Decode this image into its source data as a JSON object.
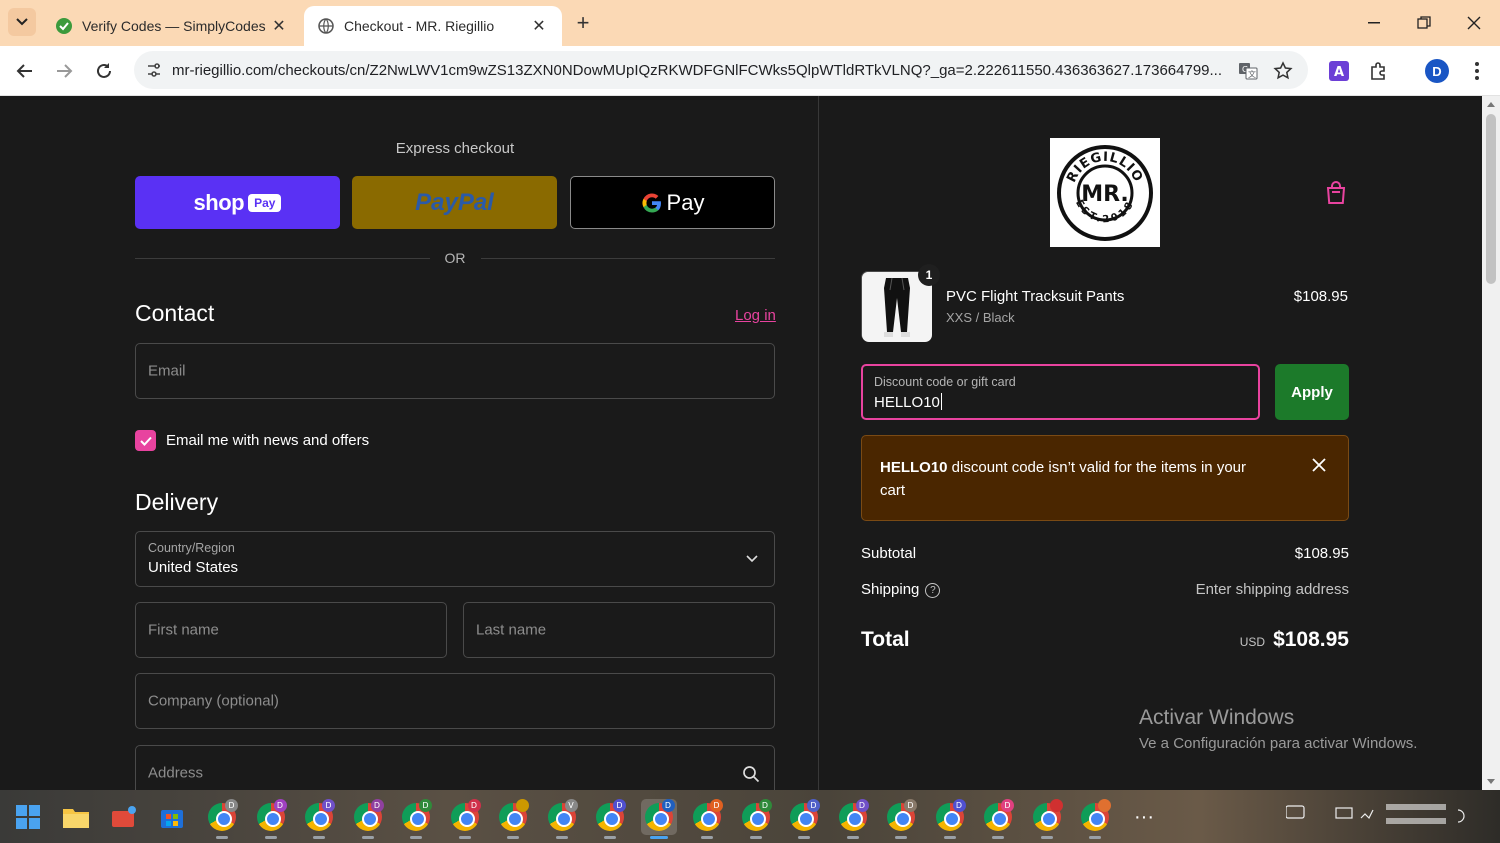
{
  "browser": {
    "tabs": [
      {
        "title": "Verify Codes — SimplyCodes",
        "active": false
      },
      {
        "title": "Checkout - MR. Riegillio",
        "active": true
      }
    ],
    "url": "mr-riegillio.com/checkouts/cn/Z2NwLWV1cm9wZS13ZXN0NDowMUpIQzRKWDFGNlFCWks5QlpWTldRTkVLNQ?_ga=2.222611550.436363627.173664799...",
    "profile_initial": "D"
  },
  "checkout": {
    "express_title": "Express checkout",
    "shop_pay_label": "shop",
    "shop_pay_sub": "Pay",
    "paypal_label": "PayPal",
    "gpay_label": "Pay",
    "or_label": "OR",
    "contact_title": "Contact",
    "login_label": "Log in",
    "email_placeholder": "Email",
    "newsletter_label": "Email me with news and offers",
    "delivery_title": "Delivery",
    "country_label": "Country/Region",
    "country_value": "United States",
    "first_name_placeholder": "First name",
    "last_name_placeholder": "Last name",
    "company_placeholder": "Company (optional)",
    "address_placeholder": "Address"
  },
  "summary": {
    "cart_icon": "shopping-bag-icon",
    "product": {
      "name": "PVC Flight Tracksuit Pants",
      "variant": "XXS / Black",
      "price": "$108.95",
      "quantity": "1"
    },
    "discount_label": "Discount code or gift card",
    "discount_value": "HELLO10",
    "apply_label": "Apply",
    "error_code": "HELLO10",
    "error_text": " discount code isn’t valid for the items in your cart",
    "subtotal_label": "Subtotal",
    "subtotal_value": "$108.95",
    "shipping_label": "Shipping",
    "shipping_value": "Enter shipping address",
    "total_label": "Total",
    "total_currency": "USD",
    "total_value": "$108.95"
  },
  "watermark": {
    "line1": "Activar Windows",
    "line2": "Ve a Configuración para activar Windows."
  },
  "taskbar": {
    "chrome_badges": [
      "D",
      "D",
      "D",
      "D",
      "D",
      "D",
      "",
      "V",
      "D",
      "D",
      "D",
      "D",
      "D",
      "D",
      "D",
      "D",
      "D",
      "",
      ""
    ]
  },
  "colors": {
    "accent_pink": "#e8439f",
    "apply_green": "#1c7a2a",
    "shop_pay": "#5a31f4",
    "paypal": "#8a6a00",
    "error_bg": "#4a2600"
  }
}
